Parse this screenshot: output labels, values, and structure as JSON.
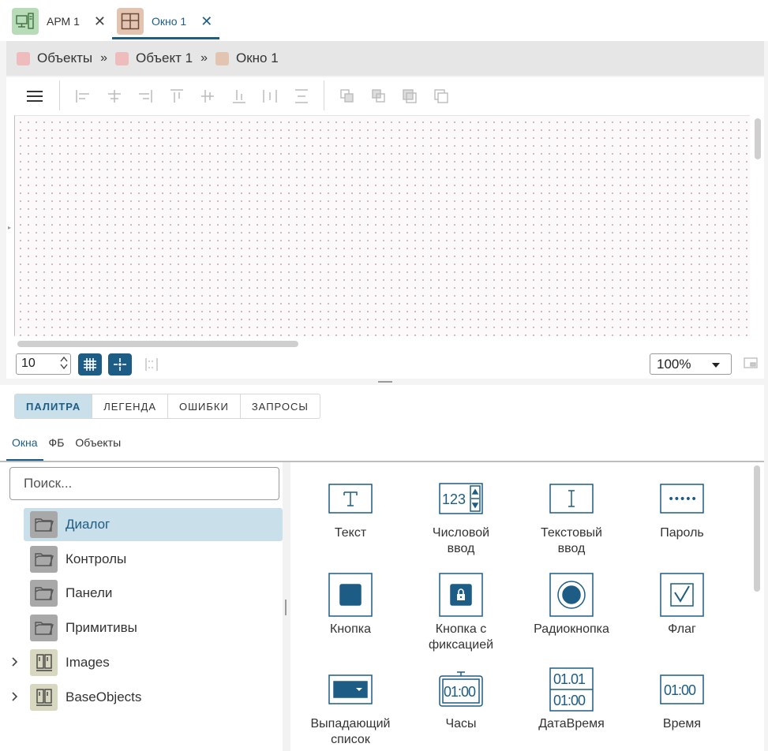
{
  "colors": {
    "accent": "#1d5c85",
    "selection": "#c9dfea",
    "arm_tab_icon": "#b8dcb8",
    "window_tab_icon": "#e2c4b0",
    "crumb_objects": "#eebcbc",
    "crumb_object": "#eebcbc",
    "crumb_window": "#e2c4b0"
  },
  "tabs": [
    {
      "label": "АРМ 1",
      "icon": "workstation-icon",
      "active": false
    },
    {
      "label": "Окно 1",
      "icon": "window-layout-icon",
      "active": true
    }
  ],
  "breadcrumb": [
    {
      "label": "Объекты"
    },
    {
      "label": "Объект 1"
    },
    {
      "label": "Окно 1"
    }
  ],
  "breadcrumb_separator": "»",
  "toolbar": {
    "menu_icon": "hamburger-icon",
    "align_icons": [
      "align-left-icon",
      "align-center-h-icon",
      "align-right-icon",
      "align-top-icon",
      "align-middle-icon",
      "align-bottom-icon",
      "distribute-h-icon",
      "distribute-v-icon"
    ],
    "order_icons": [
      "bring-front-icon",
      "send-back-icon",
      "bring-forward-icon",
      "send-backward-icon"
    ]
  },
  "editor": {
    "grid_step": "10",
    "zoom": "100%"
  },
  "section_tabs": [
    "ПАЛИТРА",
    "ЛЕГЕНДА",
    "ОШИБКИ",
    "ЗАПРОСЫ"
  ],
  "sub_tabs": [
    "Окна",
    "ФБ",
    "Объекты"
  ],
  "search": {
    "placeholder": "Поиск...",
    "value": ""
  },
  "tree": [
    {
      "label": "Диалог",
      "icon": "folder-icon",
      "selected": true,
      "expandable": false
    },
    {
      "label": "Контролы",
      "icon": "folder-icon",
      "selected": false,
      "expandable": false
    },
    {
      "label": "Панели",
      "icon": "folder-icon",
      "selected": false,
      "expandable": false
    },
    {
      "label": "Примитивы",
      "icon": "folder-icon",
      "selected": false,
      "expandable": false
    },
    {
      "label": "Images",
      "icon": "library-icon",
      "selected": false,
      "expandable": true
    },
    {
      "label": "BaseObjects",
      "icon": "library-icon",
      "selected": false,
      "expandable": true
    }
  ],
  "palette": [
    {
      "label": "Текст",
      "icon": "text-icon"
    },
    {
      "label": "Числовой\nввод",
      "icon": "numeric-input-icon",
      "icon_text": "123"
    },
    {
      "label": "Текстовый\nввод",
      "icon": "text-input-icon"
    },
    {
      "label": "Пароль",
      "icon": "password-icon",
      "icon_text": "•••••"
    },
    {
      "label": "Кнопка",
      "icon": "button-icon"
    },
    {
      "label": "Кнопка с\nфиксацией",
      "icon": "toggle-button-icon"
    },
    {
      "label": "Радиокнопка",
      "icon": "radio-icon"
    },
    {
      "label": "Флаг",
      "icon": "checkbox-icon"
    },
    {
      "label": "Выпадающий\nсписок",
      "icon": "dropdown-icon"
    },
    {
      "label": "Часы",
      "icon": "clock-icon",
      "icon_text": "01:00"
    },
    {
      "label": "ДатаВремя",
      "icon": "datetime-icon",
      "icon_text": "01.01",
      "icon_text2": "01:00"
    },
    {
      "label": "Время",
      "icon": "time-icon",
      "icon_text": "01:00"
    }
  ]
}
